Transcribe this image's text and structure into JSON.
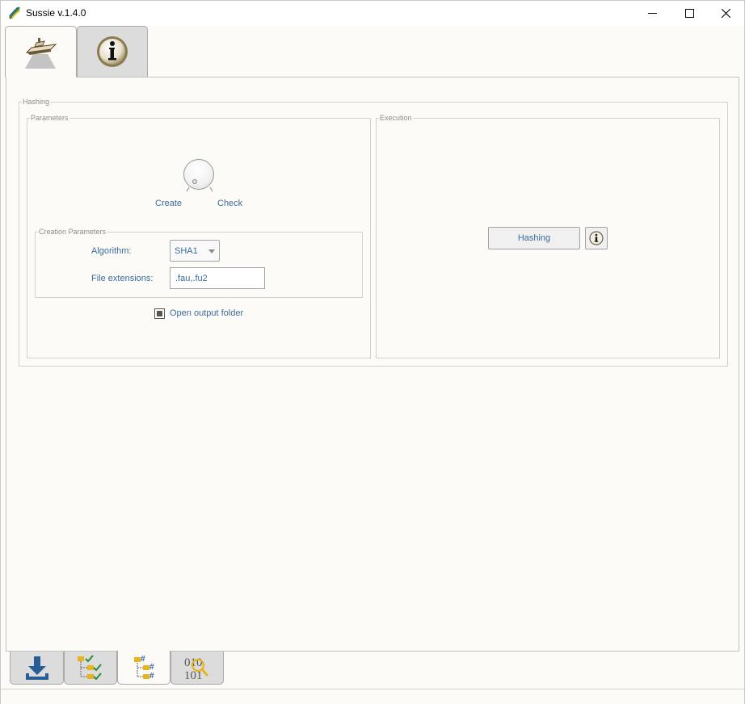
{
  "window": {
    "title": "Sussie v.1.4.0",
    "app_icon": "sussie-logo-icon",
    "controls": [
      "minimize-icon",
      "maximize-icon",
      "close-icon"
    ]
  },
  "top_tabs": [
    {
      "icon": "ship-icon",
      "active": true
    },
    {
      "icon": "info-icon",
      "active": false
    }
  ],
  "hashing": {
    "group_title": "Hashing",
    "parameters": {
      "group_title": "Parameters",
      "mode_left_label": "Create",
      "mode_right_label": "Check",
      "creation": {
        "group_title": "Creation Parameters",
        "algorithm_label": "Algorithm:",
        "algorithm_value": "SHA1",
        "extensions_label": "File extensions:",
        "extensions_value": ".fau,.fu2"
      },
      "open_output_label": "Open output folder",
      "open_output_checked": true
    },
    "execution": {
      "group_title": "Execution",
      "run_button_label": "Hashing",
      "info_icon": "info-icon"
    }
  },
  "bottom_tabs": [
    {
      "icon": "download-icon",
      "active": false
    },
    {
      "icon": "tree-check-icon",
      "active": false
    },
    {
      "icon": "tree-hash-icon",
      "active": true
    },
    {
      "icon": "binary-search-icon",
      "active": false
    }
  ],
  "colors": {
    "label_blue": "#3c6b9a",
    "background": "#fcfbf8",
    "tab_inactive": "#dcdcdc"
  }
}
